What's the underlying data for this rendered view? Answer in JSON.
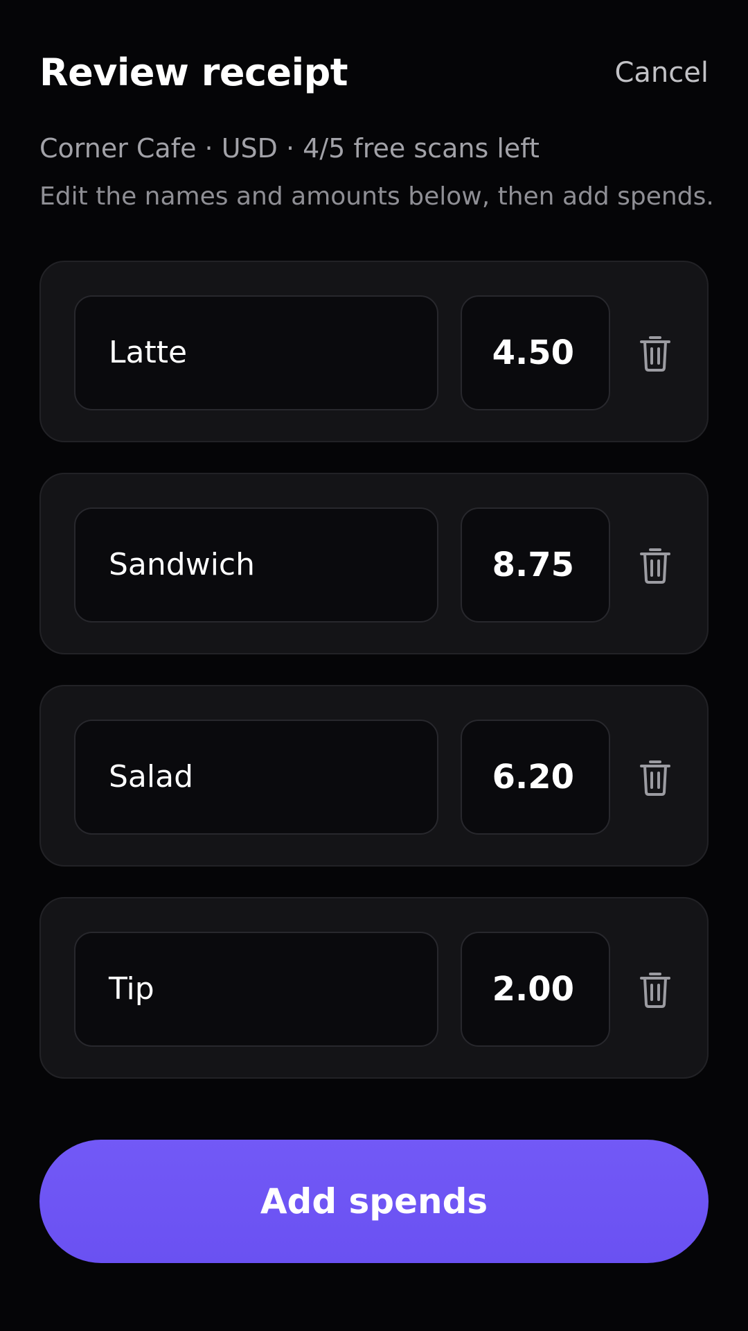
{
  "header": {
    "title": "Review receipt",
    "cancel_label": "Cancel"
  },
  "receipt": {
    "merchant": "Corner Cafe",
    "currency": "USD",
    "scans_left": "4/5 free scans left",
    "meta_line": "Corner Cafe · USD · 4/5 free scans left",
    "instructions": "Edit the names and amounts below, then add spends."
  },
  "items": [
    {
      "name": "Latte",
      "amount": "4.50",
      "delete_icon": "trash-icon"
    },
    {
      "name": "Sandwich",
      "amount": "8.75",
      "delete_icon": "trash-icon"
    },
    {
      "name": "Salad",
      "amount": "6.20",
      "delete_icon": "trash-icon"
    },
    {
      "name": "Tip",
      "amount": "2.00",
      "delete_icon": "trash-icon"
    }
  ],
  "actions": {
    "add_spends_label": "Add spends"
  },
  "colors": {
    "background": "#050507",
    "card": "#141417",
    "field": "#0a0a0d",
    "accent": "#6d55f4",
    "muted_text": "#a2a2a8"
  }
}
